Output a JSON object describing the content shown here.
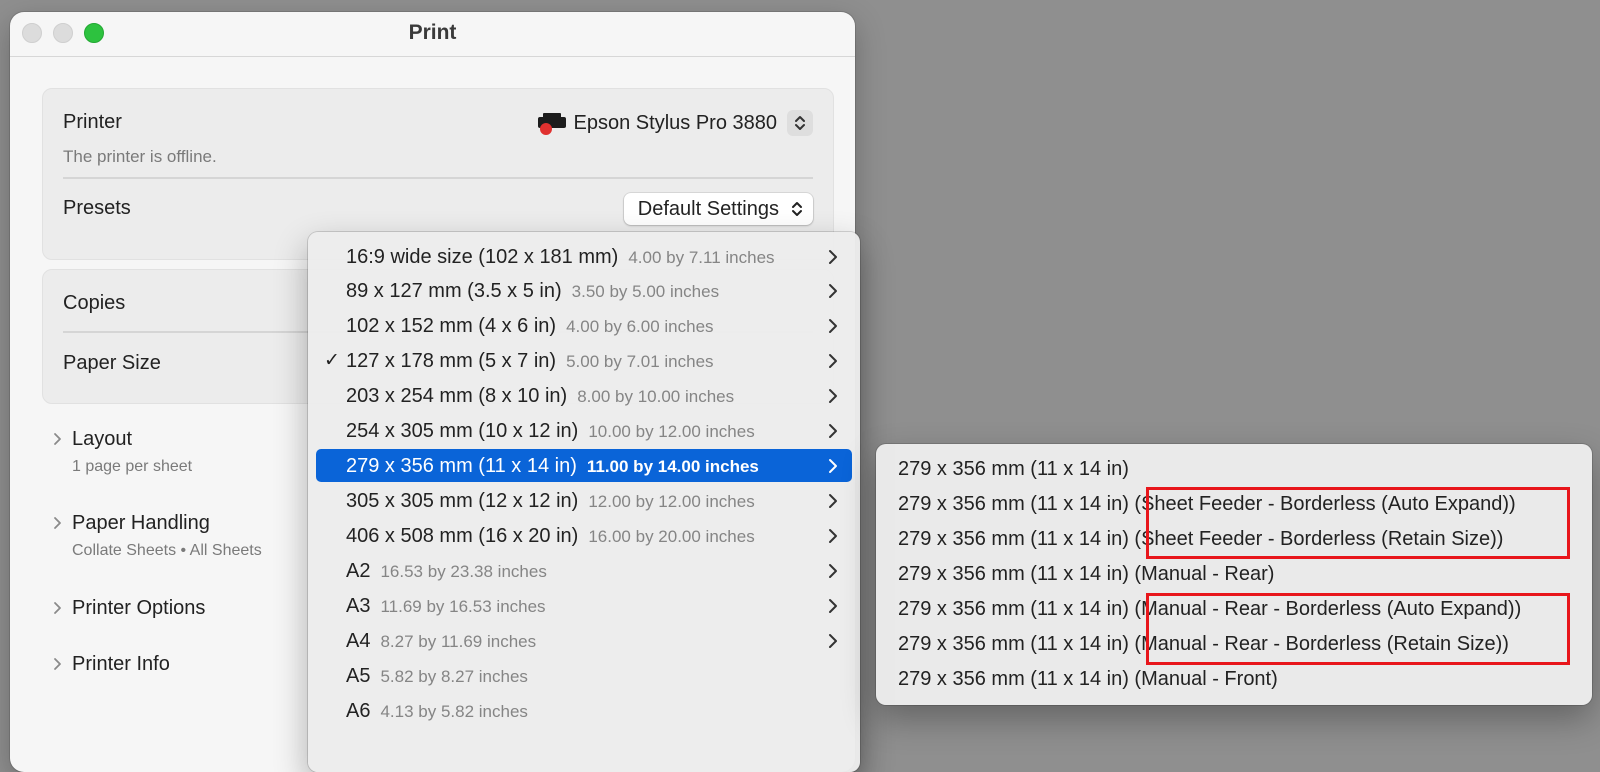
{
  "window": {
    "title": "Print",
    "controls": [
      "close",
      "minimize",
      "maximize"
    ]
  },
  "printer": {
    "label": "Printer",
    "selected": "Epson Stylus Pro 3880",
    "status": "The printer is offline.",
    "icon": "printer-icon",
    "status_color": "#e0312f"
  },
  "presets": {
    "label": "Presets",
    "selected": "Default Settings"
  },
  "copies": {
    "label": "Copies"
  },
  "paper_size": {
    "label": "Paper Size"
  },
  "sections": [
    {
      "title": "Layout",
      "subtitle": "1 page per sheet"
    },
    {
      "title": "Paper Handling",
      "subtitle": "Collate Sheets • All Sheets"
    },
    {
      "title": "Printer Options",
      "subtitle": ""
    },
    {
      "title": "Printer Info",
      "subtitle": ""
    }
  ],
  "paper_menu": {
    "items": [
      {
        "label": "16:9 wide size (102 x 181 mm)",
        "detail": "4.00 by 7.11 inches",
        "checked": "",
        "has_submenu": true
      },
      {
        "label": "89 x 127 mm (3.5 x 5 in)",
        "detail": "3.50 by 5.00 inches",
        "checked": "",
        "has_submenu": true
      },
      {
        "label": "102 x 152 mm (4 x 6 in)",
        "detail": "4.00 by 6.00 inches",
        "checked": "",
        "has_submenu": true
      },
      {
        "label": "127 x 178 mm (5 x 7 in)",
        "detail": "5.00 by 7.01 inches",
        "checked": "✓",
        "has_submenu": true
      },
      {
        "label": "203 x 254 mm (8 x 10 in)",
        "detail": "8.00 by 10.00 inches",
        "checked": "",
        "has_submenu": true
      },
      {
        "label": "254 x 305 mm (10 x 12 in)",
        "detail": "10.00 by 12.00 inches",
        "checked": "",
        "has_submenu": true
      },
      {
        "label": "279 x 356 mm (11 x 14 in)",
        "detail": "11.00 by 14.00 inches",
        "checked": "",
        "has_submenu": true,
        "highlighted": true
      },
      {
        "label": "305 x 305 mm (12 x 12 in)",
        "detail": "12.00 by 12.00 inches",
        "checked": "",
        "has_submenu": true
      },
      {
        "label": "406 x 508 mm (16 x 20 in)",
        "detail": "16.00 by 20.00 inches",
        "checked": "",
        "has_submenu": true
      },
      {
        "label": "A2",
        "detail": "16.53 by 23.38 inches",
        "checked": "",
        "has_submenu": true
      },
      {
        "label": "A3",
        "detail": "11.69 by 16.53 inches",
        "checked": "",
        "has_submenu": true
      },
      {
        "label": "A4",
        "detail": "8.27 by 11.69 inches",
        "checked": "",
        "has_submenu": true
      },
      {
        "label": "A5",
        "detail": "5.82 by 8.27 inches",
        "checked": "",
        "has_submenu": false
      },
      {
        "label": "A6",
        "detail": "4.13 by 5.82 inches",
        "checked": "",
        "has_submenu": false
      }
    ],
    "highlight_color": "#0a64d8"
  },
  "submenu": {
    "items": [
      {
        "label": "279 x 356 mm (11 x 14 in)",
        "boxed": false
      },
      {
        "label": "279 x 356 mm (11 x 14 in) (Sheet Feeder - Borderless (Auto Expand))",
        "boxed": true
      },
      {
        "label": "279 x 356 mm (11 x 14 in) (Sheet Feeder - Borderless (Retain Size))",
        "boxed": true
      },
      {
        "label": "279 x 356 mm (11 x 14 in) (Manual - Rear)",
        "boxed": false
      },
      {
        "label": "279 x 356 mm (11 x 14 in) (Manual - Rear - Borderless (Auto Expand))",
        "boxed": true
      },
      {
        "label": "279 x 356 mm (11 x 14 in) (Manual - Rear - Borderless (Retain Size))",
        "boxed": true
      },
      {
        "label": "279 x 356 mm (11 x 14 in) (Manual - Front)",
        "boxed": false
      }
    ],
    "annotation_color": "#e8161b"
  }
}
